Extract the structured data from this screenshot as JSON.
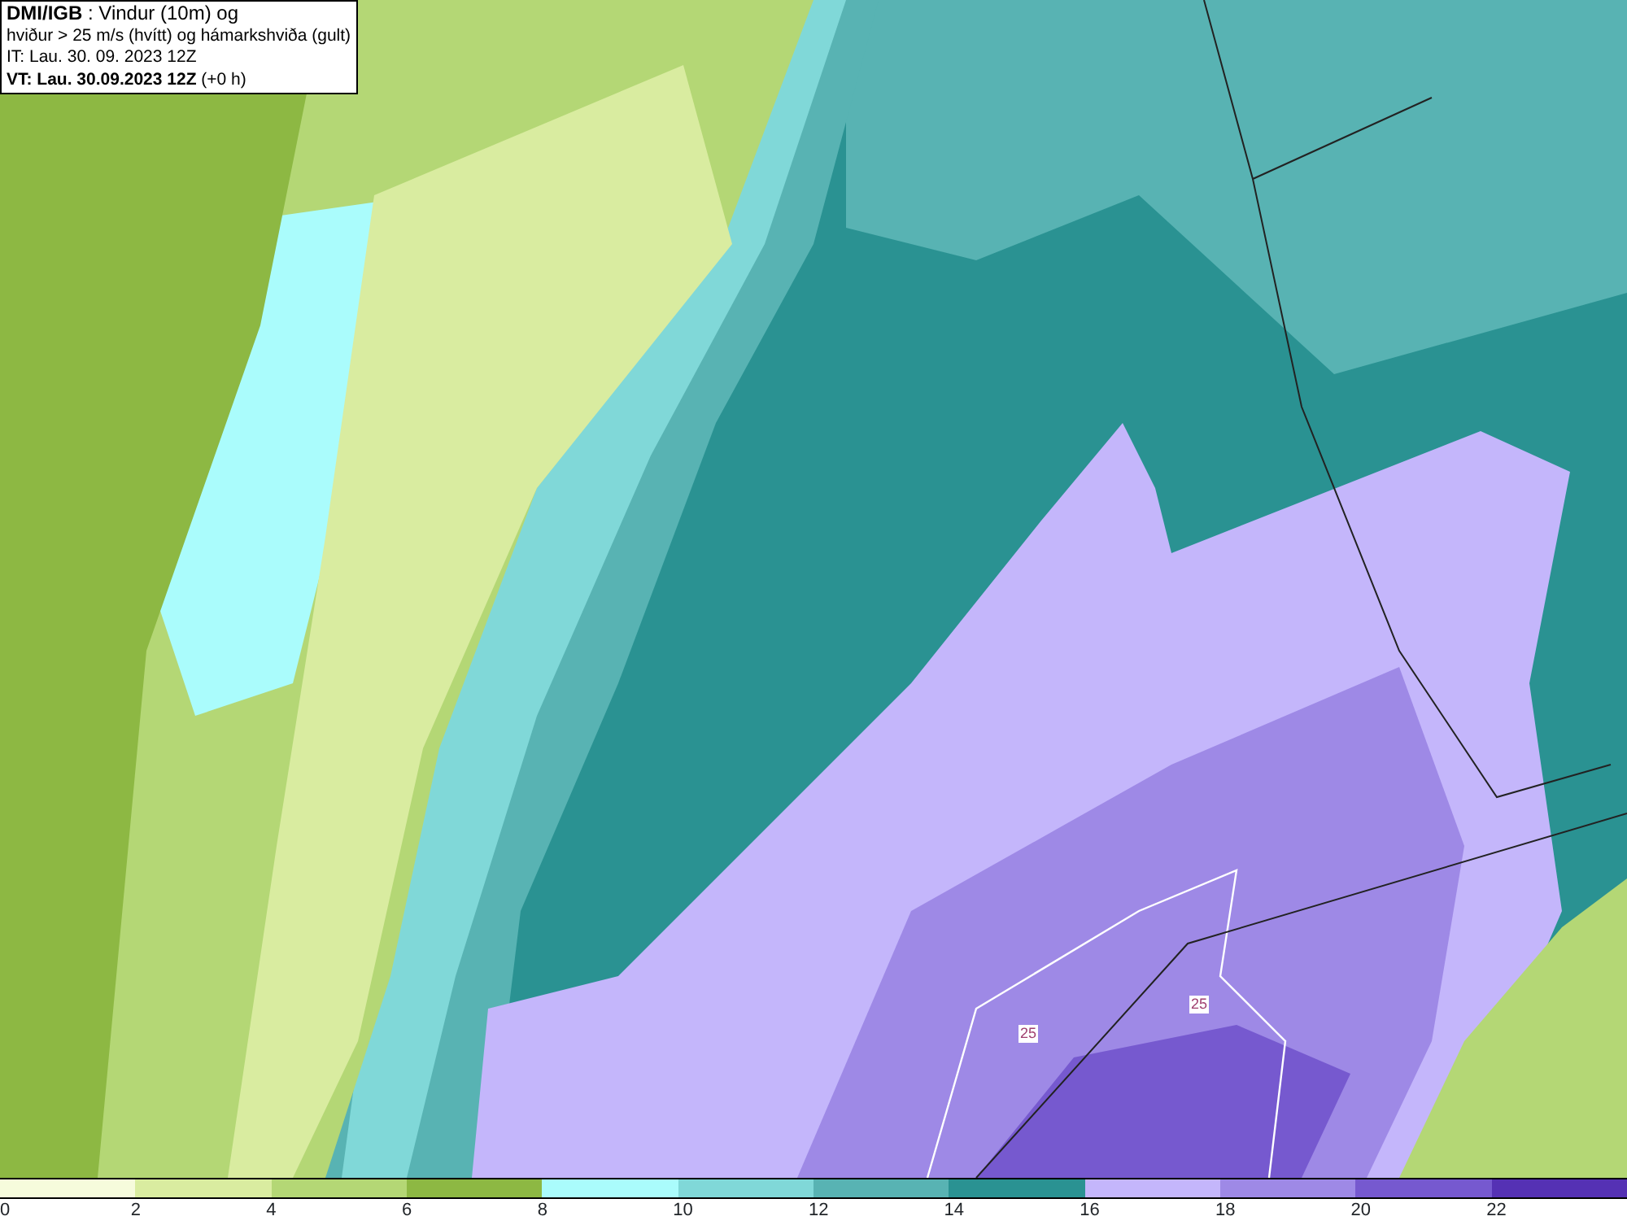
{
  "title_box": {
    "lines": [
      "**DMI/IGB** : Vindur (10m) og",
      "hviður > 25 m/s (hvítt) og hámarkshviða (gult)",
      "IT: Lau. 30. 09. 2023 12Z",
      "**VT: Lau. 30.09.2023 12Z** (+0 h)"
    ]
  },
  "contour_labels": [
    {
      "text": "25"
    },
    {
      "text": "25"
    }
  ],
  "legend": [
    {
      "label": "0",
      "color": "#f6fbdc"
    },
    {
      "label": "2",
      "color": "#d9eca0"
    },
    {
      "label": "4",
      "color": "#b4d775"
    },
    {
      "label": "6",
      "color": "#8db843"
    },
    {
      "label": "8",
      "color": "#aafcfc"
    },
    {
      "label": "10",
      "color": "#80d8d8"
    },
    {
      "label": "12",
      "color": "#58b3b3"
    },
    {
      "label": "14",
      "color": "#2a9292"
    },
    {
      "label": "16",
      "color": "#c4b6fb"
    },
    {
      "label": "18",
      "color": "#9e89e6"
    },
    {
      "label": "20",
      "color": "#7659cf"
    },
    {
      "label": "22",
      "color": "#5531b4"
    }
  ]
}
